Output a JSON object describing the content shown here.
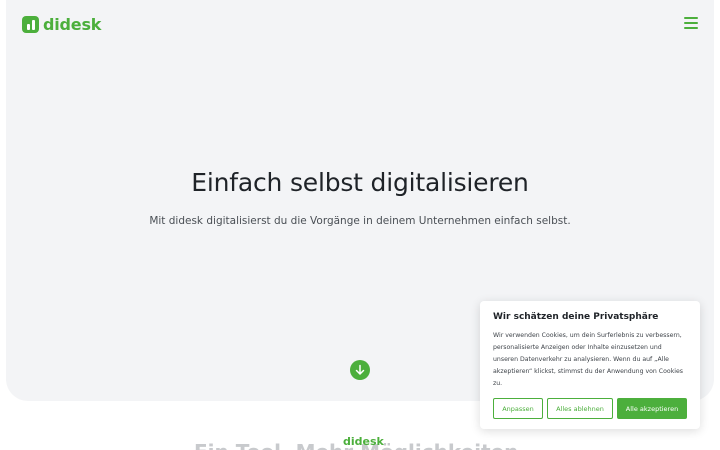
{
  "brand": {
    "name": "didesk",
    "color": "#4caf3c"
  },
  "header": {
    "menu_icon": "hamburger-menu-icon"
  },
  "hero": {
    "title": "Einfach selbst digitalisieren",
    "subtitle": "Mit didesk digitalisierst du die Vorgänge in deinem Unternehmen einfach selbst.",
    "scroll_icon": "arrow-down-circle-icon"
  },
  "next_section": {
    "label": "didesk",
    "title": "Ein Tool. Mehr Möglichkeiten."
  },
  "cookie_banner": {
    "title": "Wir schätzen deine Privatsphäre",
    "text": "Wir verwenden Cookies, um dein Surferlebnis zu verbessern, personalisierte Anzeigen oder Inhalte einzusetzen und unseren Datenverkehr zu analysieren. Wenn du auf „Alle akzeptieren“ klickst, stimmst du der Anwendung von Cookies zu.",
    "buttons": {
      "customize": "Anpassen",
      "reject_all": "Alles ablehnen",
      "accept_all": "Alle akzeptieren"
    }
  }
}
